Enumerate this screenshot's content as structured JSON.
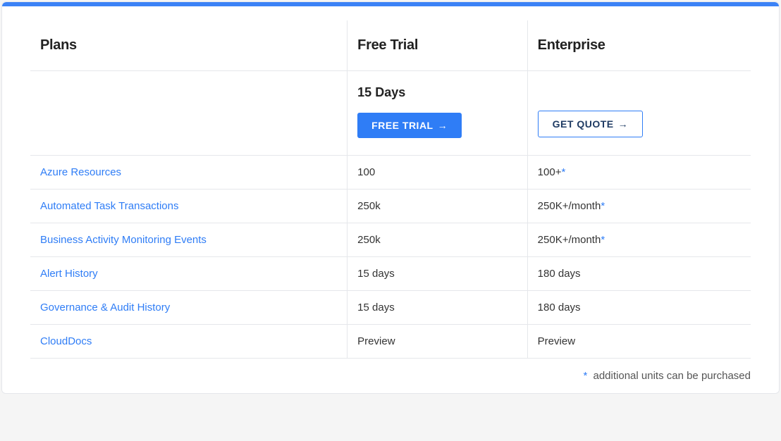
{
  "headers": {
    "plans": "Plans",
    "free_trial": "Free Trial",
    "enterprise": "Enterprise"
  },
  "cta": {
    "trial_days": "15 Days",
    "free_trial_label": "FREE TRIAL",
    "get_quote_label": "GET QUOTE"
  },
  "rows": [
    {
      "feature": "Azure Resources",
      "trial": "100",
      "enterprise": "100+",
      "star": true
    },
    {
      "feature": "Automated Task Transactions",
      "trial": "250k",
      "enterprise": "250K+/month",
      "star": true
    },
    {
      "feature": "Business Activity Monitoring Events",
      "trial": "250k",
      "enterprise": "250K+/month",
      "star": true
    },
    {
      "feature": "Alert History",
      "trial": "15 days",
      "enterprise": "180 days",
      "star": false
    },
    {
      "feature": "Governance & Audit History",
      "trial": "15 days",
      "enterprise": "180 days",
      "star": false
    },
    {
      "feature": "CloudDocs",
      "trial": "Preview",
      "enterprise": "Preview",
      "star": false
    }
  ],
  "footnote": {
    "marker": "*",
    "text": "additional units can be purchased"
  }
}
